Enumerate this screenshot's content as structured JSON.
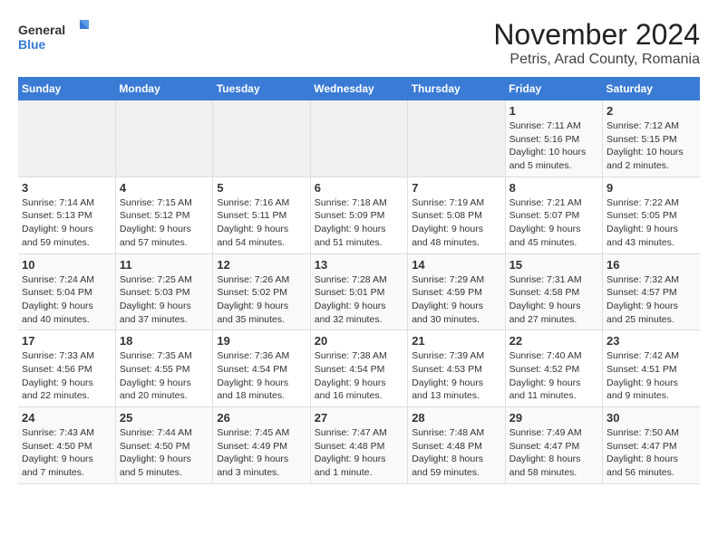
{
  "logo": {
    "name1": "General",
    "name2": "Blue"
  },
  "title": "November 2024",
  "subtitle": "Petris, Arad County, Romania",
  "headers": [
    "Sunday",
    "Monday",
    "Tuesday",
    "Wednesday",
    "Thursday",
    "Friday",
    "Saturday"
  ],
  "weeks": [
    [
      {
        "day": "",
        "info": ""
      },
      {
        "day": "",
        "info": ""
      },
      {
        "day": "",
        "info": ""
      },
      {
        "day": "",
        "info": ""
      },
      {
        "day": "",
        "info": ""
      },
      {
        "day": "1",
        "info": "Sunrise: 7:11 AM\nSunset: 5:16 PM\nDaylight: 10 hours\nand 5 minutes."
      },
      {
        "day": "2",
        "info": "Sunrise: 7:12 AM\nSunset: 5:15 PM\nDaylight: 10 hours\nand 2 minutes."
      }
    ],
    [
      {
        "day": "3",
        "info": "Sunrise: 7:14 AM\nSunset: 5:13 PM\nDaylight: 9 hours\nand 59 minutes."
      },
      {
        "day": "4",
        "info": "Sunrise: 7:15 AM\nSunset: 5:12 PM\nDaylight: 9 hours\nand 57 minutes."
      },
      {
        "day": "5",
        "info": "Sunrise: 7:16 AM\nSunset: 5:11 PM\nDaylight: 9 hours\nand 54 minutes."
      },
      {
        "day": "6",
        "info": "Sunrise: 7:18 AM\nSunset: 5:09 PM\nDaylight: 9 hours\nand 51 minutes."
      },
      {
        "day": "7",
        "info": "Sunrise: 7:19 AM\nSunset: 5:08 PM\nDaylight: 9 hours\nand 48 minutes."
      },
      {
        "day": "8",
        "info": "Sunrise: 7:21 AM\nSunset: 5:07 PM\nDaylight: 9 hours\nand 45 minutes."
      },
      {
        "day": "9",
        "info": "Sunrise: 7:22 AM\nSunset: 5:05 PM\nDaylight: 9 hours\nand 43 minutes."
      }
    ],
    [
      {
        "day": "10",
        "info": "Sunrise: 7:24 AM\nSunset: 5:04 PM\nDaylight: 9 hours\nand 40 minutes."
      },
      {
        "day": "11",
        "info": "Sunrise: 7:25 AM\nSunset: 5:03 PM\nDaylight: 9 hours\nand 37 minutes."
      },
      {
        "day": "12",
        "info": "Sunrise: 7:26 AM\nSunset: 5:02 PM\nDaylight: 9 hours\nand 35 minutes."
      },
      {
        "day": "13",
        "info": "Sunrise: 7:28 AM\nSunset: 5:01 PM\nDaylight: 9 hours\nand 32 minutes."
      },
      {
        "day": "14",
        "info": "Sunrise: 7:29 AM\nSunset: 4:59 PM\nDaylight: 9 hours\nand 30 minutes."
      },
      {
        "day": "15",
        "info": "Sunrise: 7:31 AM\nSunset: 4:58 PM\nDaylight: 9 hours\nand 27 minutes."
      },
      {
        "day": "16",
        "info": "Sunrise: 7:32 AM\nSunset: 4:57 PM\nDaylight: 9 hours\nand 25 minutes."
      }
    ],
    [
      {
        "day": "17",
        "info": "Sunrise: 7:33 AM\nSunset: 4:56 PM\nDaylight: 9 hours\nand 22 minutes."
      },
      {
        "day": "18",
        "info": "Sunrise: 7:35 AM\nSunset: 4:55 PM\nDaylight: 9 hours\nand 20 minutes."
      },
      {
        "day": "19",
        "info": "Sunrise: 7:36 AM\nSunset: 4:54 PM\nDaylight: 9 hours\nand 18 minutes."
      },
      {
        "day": "20",
        "info": "Sunrise: 7:38 AM\nSunset: 4:54 PM\nDaylight: 9 hours\nand 16 minutes."
      },
      {
        "day": "21",
        "info": "Sunrise: 7:39 AM\nSunset: 4:53 PM\nDaylight: 9 hours\nand 13 minutes."
      },
      {
        "day": "22",
        "info": "Sunrise: 7:40 AM\nSunset: 4:52 PM\nDaylight: 9 hours\nand 11 minutes."
      },
      {
        "day": "23",
        "info": "Sunrise: 7:42 AM\nSunset: 4:51 PM\nDaylight: 9 hours\nand 9 minutes."
      }
    ],
    [
      {
        "day": "24",
        "info": "Sunrise: 7:43 AM\nSunset: 4:50 PM\nDaylight: 9 hours\nand 7 minutes."
      },
      {
        "day": "25",
        "info": "Sunrise: 7:44 AM\nSunset: 4:50 PM\nDaylight: 9 hours\nand 5 minutes."
      },
      {
        "day": "26",
        "info": "Sunrise: 7:45 AM\nSunset: 4:49 PM\nDaylight: 9 hours\nand 3 minutes."
      },
      {
        "day": "27",
        "info": "Sunrise: 7:47 AM\nSunset: 4:48 PM\nDaylight: 9 hours\nand 1 minute."
      },
      {
        "day": "28",
        "info": "Sunrise: 7:48 AM\nSunset: 4:48 PM\nDaylight: 8 hours\nand 59 minutes."
      },
      {
        "day": "29",
        "info": "Sunrise: 7:49 AM\nSunset: 4:47 PM\nDaylight: 8 hours\nand 58 minutes."
      },
      {
        "day": "30",
        "info": "Sunrise: 7:50 AM\nSunset: 4:47 PM\nDaylight: 8 hours\nand 56 minutes."
      }
    ]
  ]
}
